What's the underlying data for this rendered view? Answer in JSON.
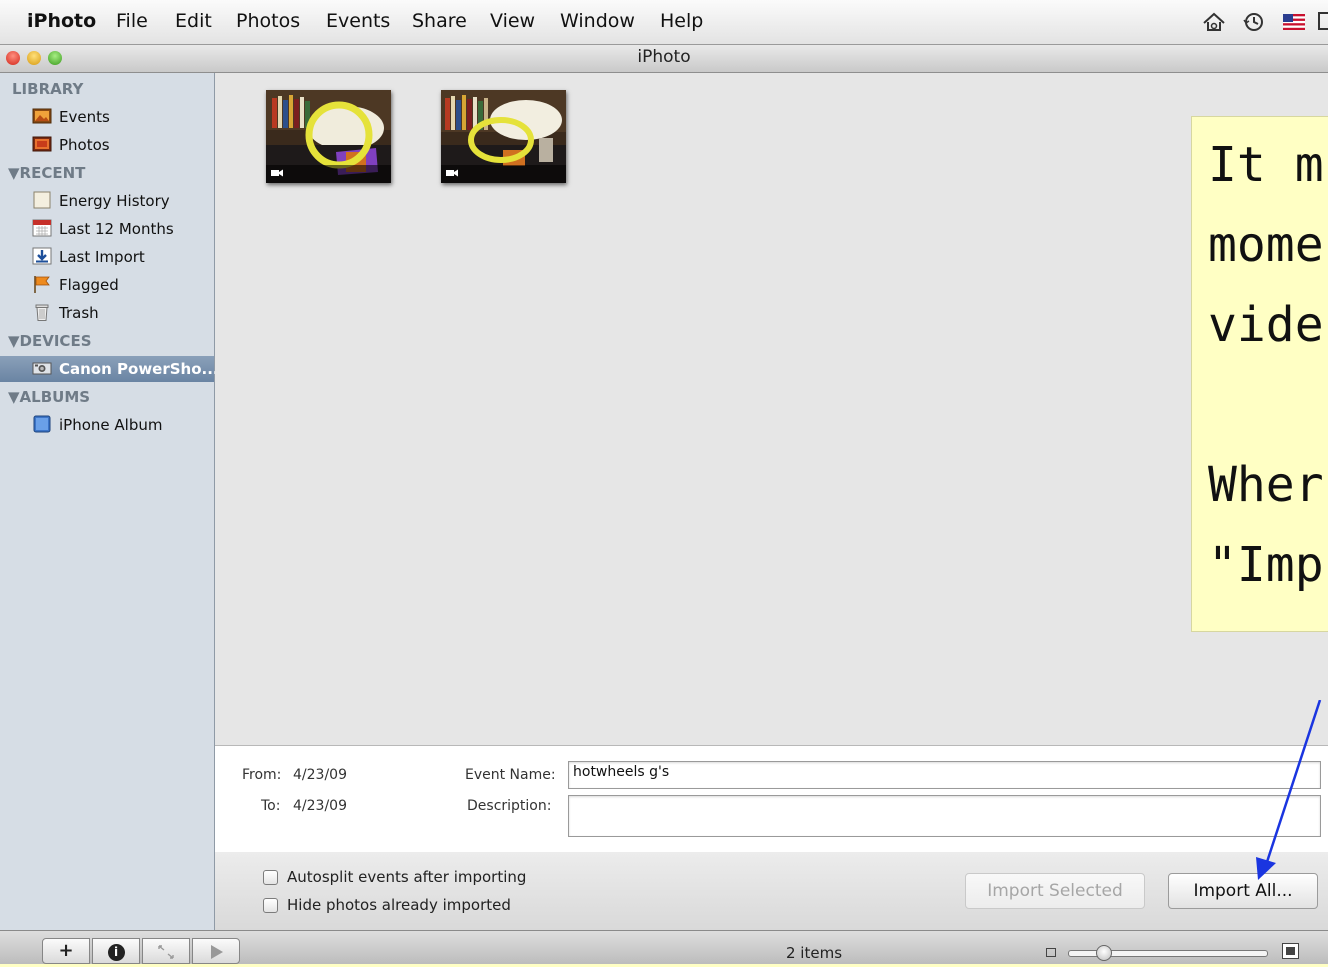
{
  "menubar": {
    "app": "iPhoto",
    "items": [
      "File",
      "Edit",
      "Photos",
      "Events",
      "Share",
      "View",
      "Window",
      "Help"
    ],
    "status_icons": [
      "time-capsule-icon",
      "time-machine-icon",
      "us-flag-icon",
      "battery-icon"
    ]
  },
  "window": {
    "title": "iPhoto"
  },
  "sidebar": {
    "sections": [
      {
        "title": "LIBRARY",
        "items": [
          {
            "label": "Events",
            "icon": "events-icon"
          },
          {
            "label": "Photos",
            "icon": "photos-icon"
          }
        ]
      },
      {
        "title": "RECENT",
        "items": [
          {
            "label": "Energy History",
            "icon": "event-album-icon"
          },
          {
            "label": "Last 12 Months",
            "icon": "calendar-icon"
          },
          {
            "label": "Last Import",
            "icon": "import-icon"
          },
          {
            "label": "Flagged",
            "icon": "flag-icon"
          },
          {
            "label": "Trash",
            "icon": "trash-icon"
          }
        ]
      },
      {
        "title": "DEVICES",
        "items": [
          {
            "label": "Canon PowerSho...",
            "icon": "camera-icon",
            "selected": true
          }
        ]
      },
      {
        "title": "ALBUMS",
        "items": [
          {
            "label": "iPhone Album",
            "icon": "album-icon"
          }
        ]
      }
    ]
  },
  "thumbnails": [
    {
      "name": "video-thumbnail-1",
      "badge": "video-camera-icon"
    },
    {
      "name": "video-thumbnail-2",
      "badge": "video-camera-icon"
    }
  ],
  "info": {
    "from_label": "From:",
    "from_value": "4/23/09",
    "to_label": "To:",
    "to_value": "4/23/09",
    "event_name_label": "Event Name:",
    "event_name_value": "hotwheels g's",
    "description_label": "Description:",
    "description_value": ""
  },
  "import": {
    "autosplit_label": "Autosplit events after importing",
    "autosplit_checked": false,
    "hide_imported_label": "Hide photos already imported",
    "hide_imported_checked": false,
    "import_selected_label": "Import Selected",
    "import_selected_enabled": false,
    "import_all_label": "Import All..."
  },
  "statusbar": {
    "buttons": [
      "+",
      "i",
      "fullscreen-icon",
      "play-icon"
    ],
    "item_count": "2 items"
  },
  "annotation": {
    "lines": [
      "It m",
      "mome",
      "vide",
      "",
      "Wher",
      "\"Imp"
    ],
    "arrow_color": "#1a35e0"
  }
}
